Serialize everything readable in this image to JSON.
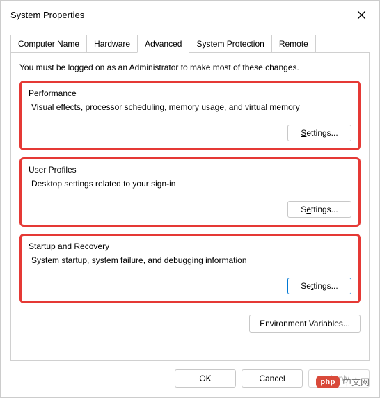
{
  "window": {
    "title": "System Properties"
  },
  "tabs": {
    "computer_name": "Computer Name",
    "hardware": "Hardware",
    "advanced": "Advanced",
    "system_protection": "System Protection",
    "remote": "Remote"
  },
  "intro": "You must be logged on as an Administrator to make most of these changes.",
  "groups": {
    "performance": {
      "title": "Performance",
      "desc": "Visual effects, processor scheduling, memory usage, and virtual memory",
      "button": "Settings..."
    },
    "user_profiles": {
      "title": "User Profiles",
      "desc": "Desktop settings related to your sign-in",
      "button": "Settings..."
    },
    "startup": {
      "title": "Startup and Recovery",
      "desc": "System startup, system failure, and debugging information",
      "button": "Settings..."
    }
  },
  "env_button": "Environment Variables...",
  "footer": {
    "ok": "OK",
    "cancel": "Cancel",
    "apply": "Apply"
  },
  "watermark": {
    "badge": "php",
    "text": "中文网"
  }
}
